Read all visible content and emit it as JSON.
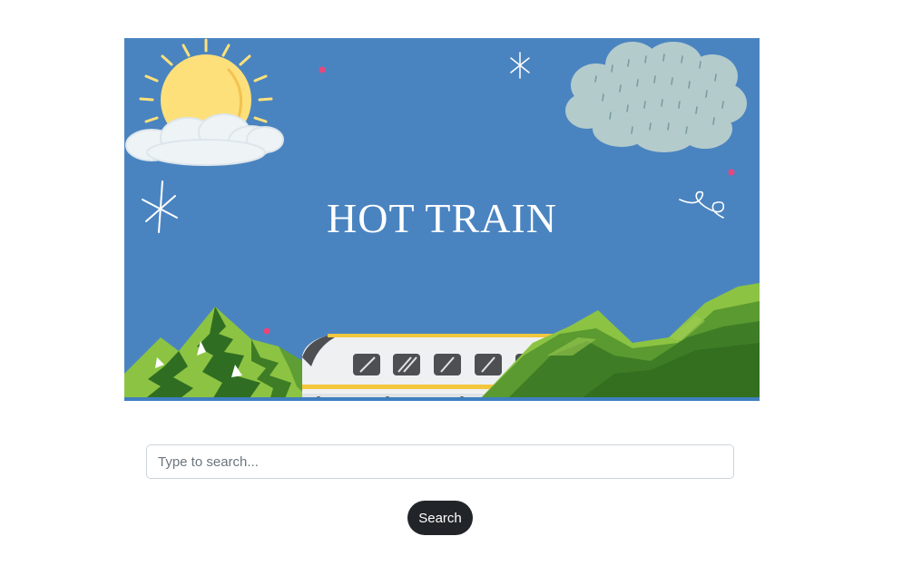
{
  "banner": {
    "title": "HOT TRAIN",
    "colors": {
      "sky": "#4a84c0",
      "sun": "#fde07a",
      "cloud_light": "#eef3f6",
      "cloud_rain": "#b4cbcc",
      "mountain_light": "#8cc342",
      "mountain_dark": "#3e7d25",
      "train_body": "#eef0f2",
      "train_stripe": "#f2c73d",
      "window": "#4e4f53",
      "accent_dot": "#e8467c"
    }
  },
  "search": {
    "placeholder": "Type to search...",
    "value": ""
  },
  "search_button": {
    "label": "Search"
  }
}
